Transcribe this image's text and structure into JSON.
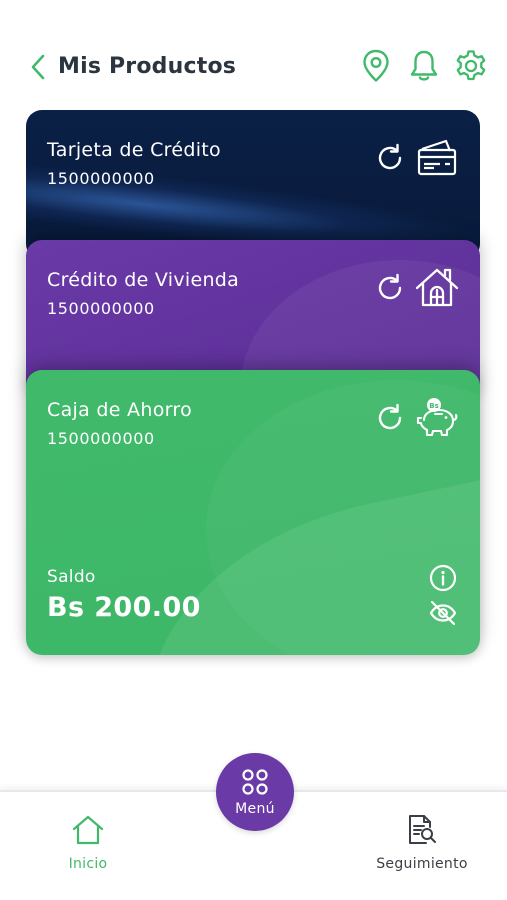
{
  "header": {
    "title": "Mis Productos",
    "icons": [
      "chevron-left-icon",
      "location-pin-icon",
      "bell-icon",
      "gear-icon"
    ]
  },
  "cards": [
    {
      "name": "Tarjeta de Crédito",
      "number": "1500000000",
      "icon": "credit-card-icon",
      "color": "#0b2046"
    },
    {
      "name": "Crédito de Vivienda",
      "number": "1500000000",
      "icon": "house-icon",
      "color": "#6a3aa6"
    },
    {
      "name": "Caja de Ahorro",
      "number": "1500000000",
      "icon": "piggy-bank-icon",
      "color": "#41b96b",
      "balance_label": "Saldo",
      "balance_value": "Bs 200.00"
    }
  ],
  "bottom_nav": {
    "home_label": "Inicio",
    "menu_label": "Menú",
    "tracking_label": "Seguimiento"
  },
  "colors": {
    "accent_green": "#41b96b",
    "accent_purple": "#6a3aa6",
    "navy": "#0b2046"
  }
}
